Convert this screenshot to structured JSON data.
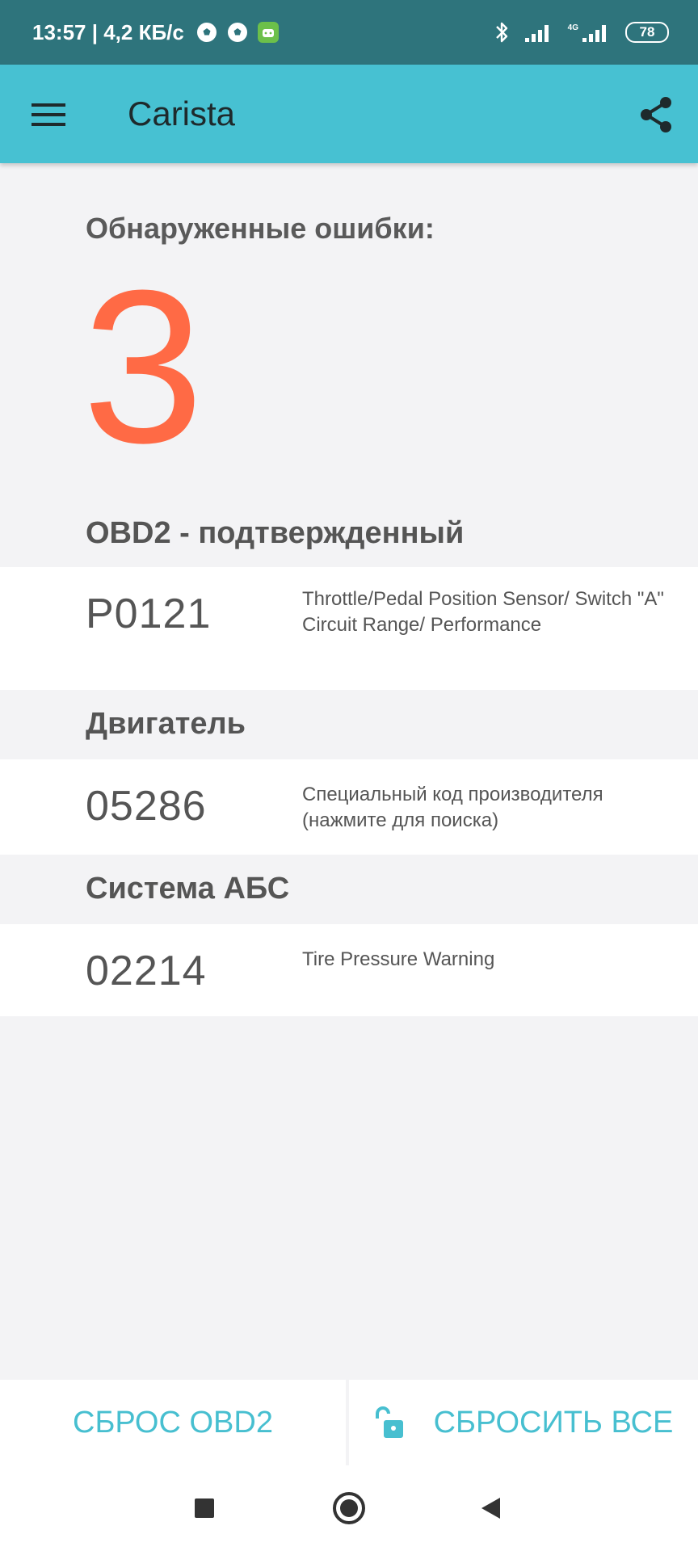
{
  "status_bar": {
    "time_speed": "13:57 | 4,2 КБ/с",
    "network_label": "4G",
    "battery": "78"
  },
  "app_bar": {
    "title": "Carista"
  },
  "errors": {
    "heading": "Обнаруженные ошибки:",
    "count": "3"
  },
  "sections": [
    {
      "title": "OBD2 - подтвержденный",
      "code": "P0121",
      "description": "Throttle/Pedal Position Sensor/ Switch \"A\" Circuit Range/ Performance"
    },
    {
      "title": "Двигатель",
      "code": "05286",
      "description": "Специальный код производителя (нажмите для поиска)"
    },
    {
      "title": "Система АБС",
      "code": "02214",
      "description": "Tire Pressure Warning"
    }
  ],
  "actions": {
    "reset_obd2": "СБРОС OBD2",
    "reset_all": "СБРОСИТЬ ВСЕ"
  },
  "colors": {
    "status_bar": "#2e747c",
    "app_bar": "#47c1d2",
    "accent": "#47bfd0",
    "count": "#ff6a45",
    "background": "#f3f3f5"
  },
  "icons": {
    "menu": "hamburger-menu-icon",
    "share": "share-icon",
    "unlock": "unlock-icon",
    "nav_recents": "square-icon",
    "nav_home": "circle-icon",
    "nav_back": "triangle-back-icon"
  }
}
